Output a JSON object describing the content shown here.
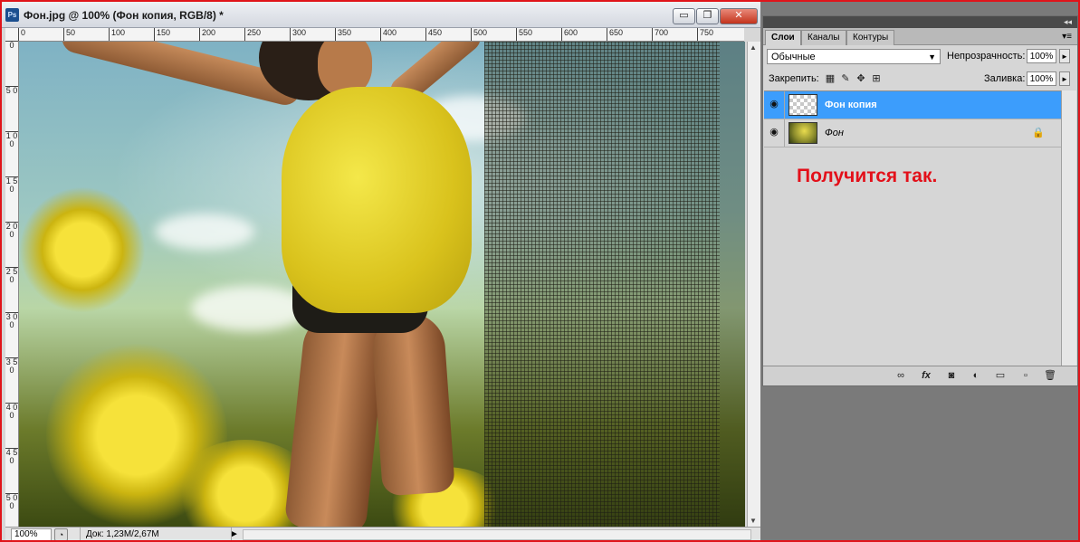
{
  "document": {
    "title": "Фон.jpg @ 100% (Фон копия, RGB/8) *",
    "app_icon": "Ps",
    "window_buttons": {
      "minimize": "▭",
      "restore": "❐",
      "close": "✕"
    },
    "ruler_top": [
      "0",
      "50",
      "100",
      "150",
      "200",
      "250",
      "300",
      "350",
      "400",
      "450",
      "500",
      "550",
      "600",
      "650",
      "700",
      "750"
    ],
    "ruler_left": [
      "0",
      "5 0",
      "1 0 0",
      "1 5 0",
      "2 0 0",
      "2 5 0",
      "3 0 0",
      "3 5 0",
      "4 0 0",
      "4 5 0",
      "5 0 0"
    ]
  },
  "statusbar": {
    "zoom": "100%",
    "doc_info": "Док: 1,23M/2,67M",
    "arrow": "►"
  },
  "layers_panel": {
    "tabs": [
      "Слои",
      "Каналы",
      "Контуры"
    ],
    "active_tab": "Слои",
    "collapse_glyph": "◂◂",
    "menu_glyph": "▾≡",
    "blend_mode": "Обычные",
    "opacity_label": "Непрозрачность:",
    "opacity_value": "100%",
    "lock_label": "Закрепить:",
    "fill_label": "Заливка:",
    "fill_value": "100%",
    "layers": [
      {
        "name": "Фон копия",
        "selected": true,
        "visible": true,
        "thumb": "transparent"
      },
      {
        "name": "Фон",
        "selected": false,
        "visible": true,
        "thumb": "photo",
        "locked": true
      }
    ]
  },
  "annotation": {
    "text": "Получится так.",
    "color": "#e3101a"
  },
  "colors": {
    "frame_border": "#e0141a",
    "selected_layer": "#3c9dfc",
    "panel_bg": "#d6d6d6"
  }
}
